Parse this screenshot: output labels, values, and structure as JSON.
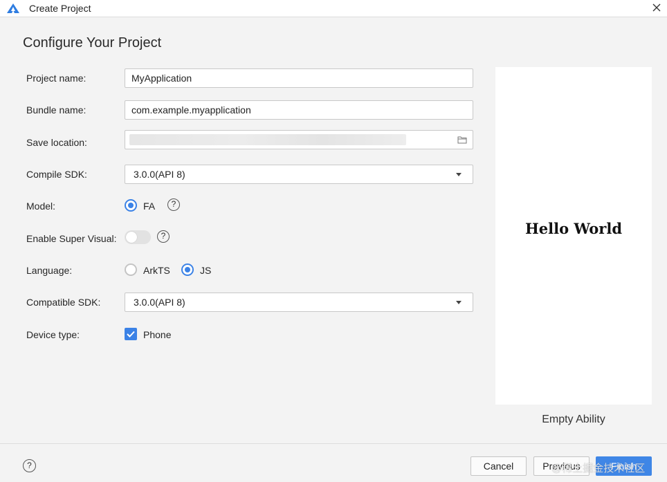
{
  "window": {
    "title": "Create Project",
    "icon": "harmony-logo-icon",
    "close_icon": "close-icon"
  },
  "heading": "Configure Your Project",
  "form": {
    "project_name_label": "Project name:",
    "project_name_value": "MyApplication",
    "bundle_name_label": "Bundle name:",
    "bundle_name_value": "com.example.myapplication",
    "save_location_label": "Save location:",
    "compile_sdk_label": "Compile SDK:",
    "compile_sdk_value": "3.0.0(API 8)",
    "model_label": "Model:",
    "model_option": "FA",
    "enable_super_visual_label": "Enable Super Visual:",
    "language_label": "Language:",
    "language_options": [
      "ArkTS",
      "JS"
    ],
    "language_selected": "JS",
    "compatible_sdk_label": "Compatible SDK:",
    "compatible_sdk_value": "3.0.0(API 8)",
    "device_type_label": "Device type:",
    "device_type_option": "Phone"
  },
  "preview": {
    "text": "Hello World",
    "template_name": "Empty Ability"
  },
  "footer": {
    "help_icon": "help-icon",
    "cancel_label": "Cancel",
    "previous_label": "Previous",
    "finish_label": "Finish"
  },
  "watermark": "@稀土掘金技术社区",
  "colors": {
    "accent": "#3b82e6",
    "background": "#f3f3f3"
  }
}
